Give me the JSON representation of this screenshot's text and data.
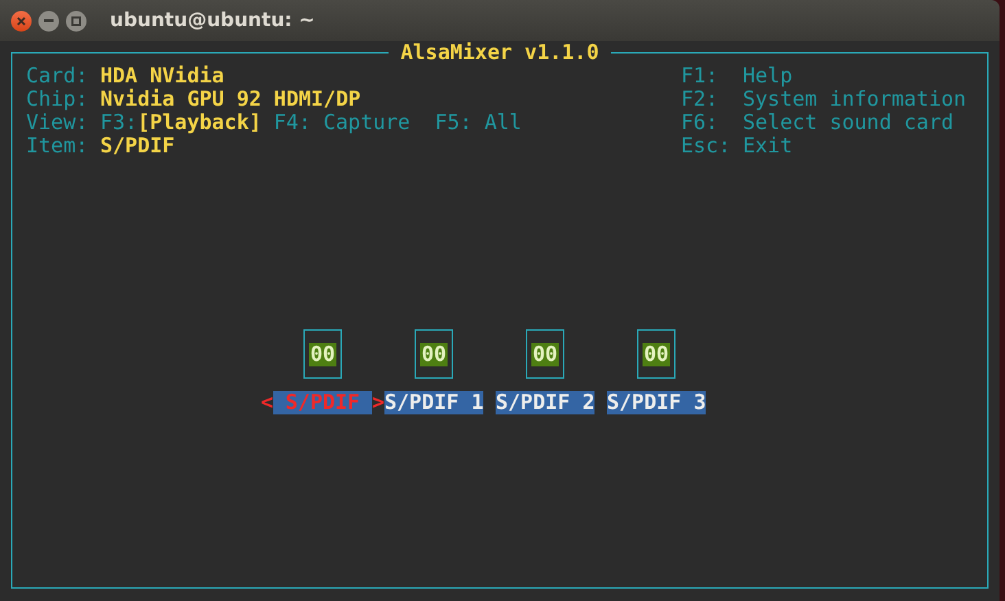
{
  "window": {
    "title": "ubuntu@ubuntu: ~"
  },
  "mixer": {
    "title": "AlsaMixer v1.1.0",
    "info": [
      {
        "label": "Card:",
        "value": "HDA NVidia"
      },
      {
        "label": "Chip:",
        "value": "Nvidia GPU 92 HDMI/DP"
      },
      {
        "label": "View:",
        "views": [
          {
            "key": "F3:",
            "name": "Playback",
            "selected": true
          },
          {
            "key": "F4:",
            "name": "Capture",
            "selected": false
          },
          {
            "key": "F5:",
            "name": "All",
            "selected": false
          }
        ]
      },
      {
        "label": "Item:",
        "value": "S/PDIF"
      }
    ],
    "keys": [
      {
        "key": "F1:",
        "action": "Help"
      },
      {
        "key": "F2:",
        "action": "System information"
      },
      {
        "key": "F6:",
        "action": "Select sound card"
      },
      {
        "key": "Esc:",
        "action": "Exit"
      }
    ],
    "selection_markers": [
      "<",
      ">"
    ],
    "view_brackets": [
      "[",
      "]"
    ],
    "controls": [
      {
        "name": "S/PDIF",
        "value": "00",
        "selected": true
      },
      {
        "name": "S/PDIF 1",
        "value": "00",
        "selected": false
      },
      {
        "name": "S/PDIF 2",
        "value": "00",
        "selected": false
      },
      {
        "name": "S/PDIF 3",
        "value": "00",
        "selected": false
      }
    ]
  }
}
